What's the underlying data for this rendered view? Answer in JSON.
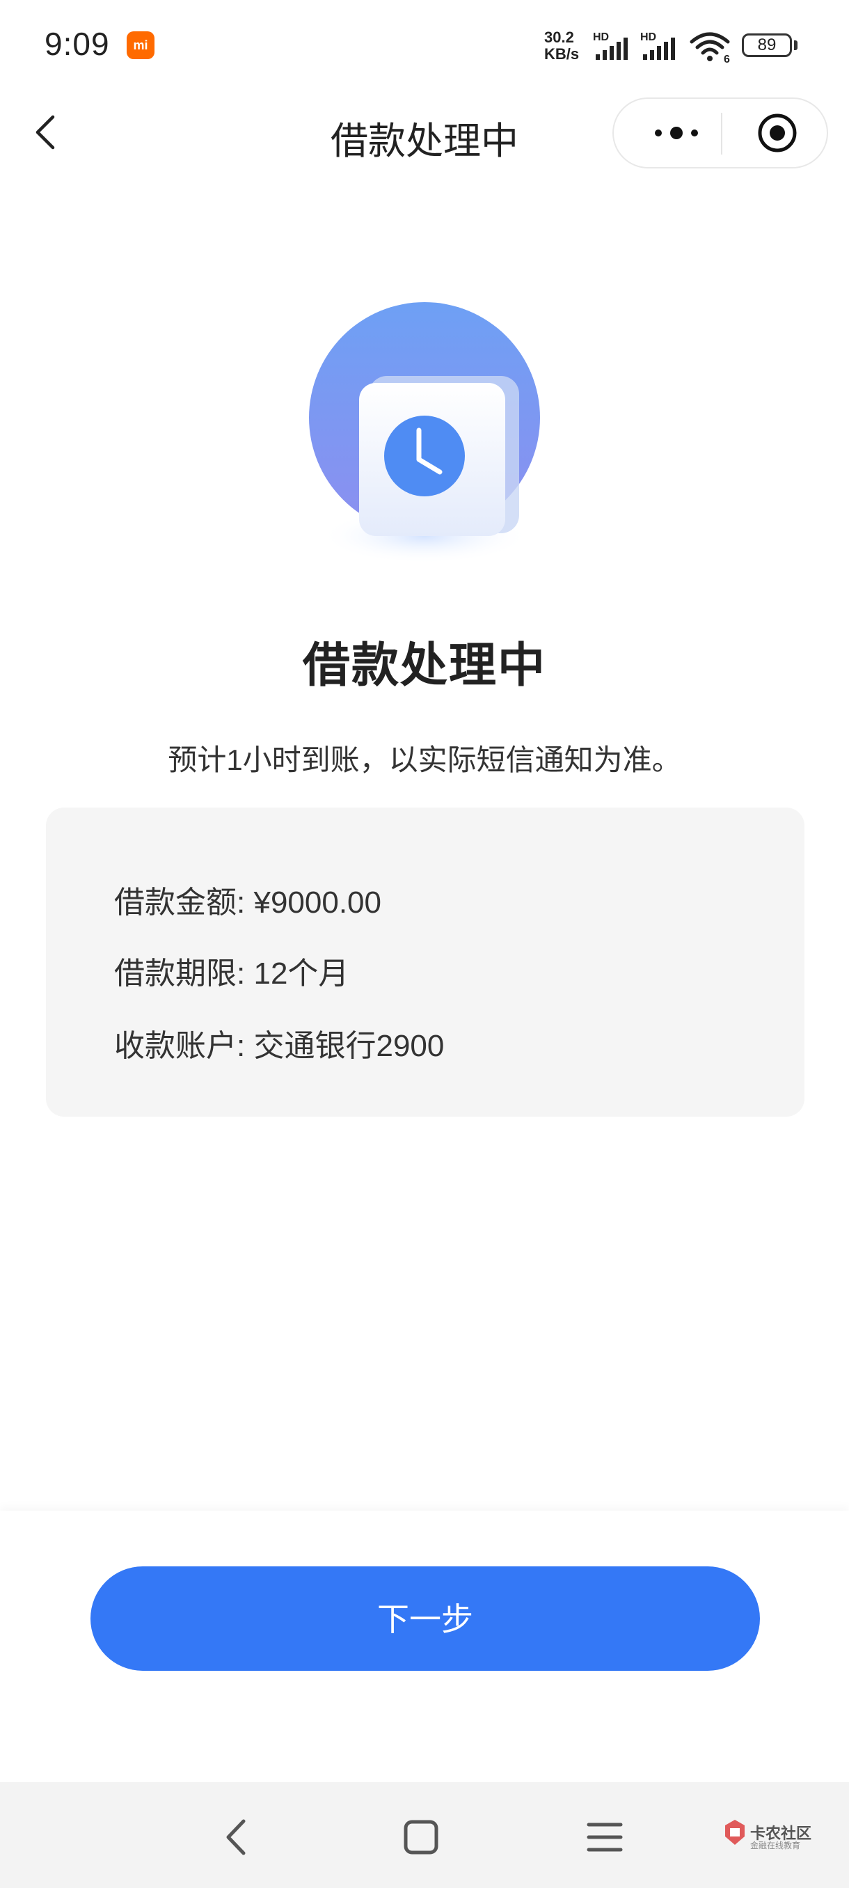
{
  "status_bar": {
    "time": "9:09",
    "mi_badge": "mi",
    "net_speed_value": "30.2",
    "net_speed_unit": "KB/s",
    "signal_label_1": "HD",
    "signal_label_2": "HD",
    "wifi_label": "6",
    "battery": "89"
  },
  "nav": {
    "title": "借款处理中",
    "icons": {
      "back": "chevron-left-icon",
      "more": "more-dots-icon",
      "close": "target-close-icon"
    }
  },
  "main": {
    "illustration_icon": "clock-icon",
    "title": "借款处理中",
    "subtitle": "预计1小时到账，以实际短信通知为准。"
  },
  "info": {
    "amount_label": "借款金额:",
    "amount_value": "¥9000.00",
    "term_label": "借款期限:",
    "term_value": "12个月",
    "account_label": "收款账户:",
    "account_value": "交通银行2900"
  },
  "actions": {
    "next_label": "下一步"
  },
  "watermark": {
    "text": "卡农社区",
    "sub": "金融在线教育"
  },
  "colors": {
    "accent": "#3478f6",
    "illustration_blue": "#6b9bf0",
    "card_bg": "#f5f5f5"
  }
}
